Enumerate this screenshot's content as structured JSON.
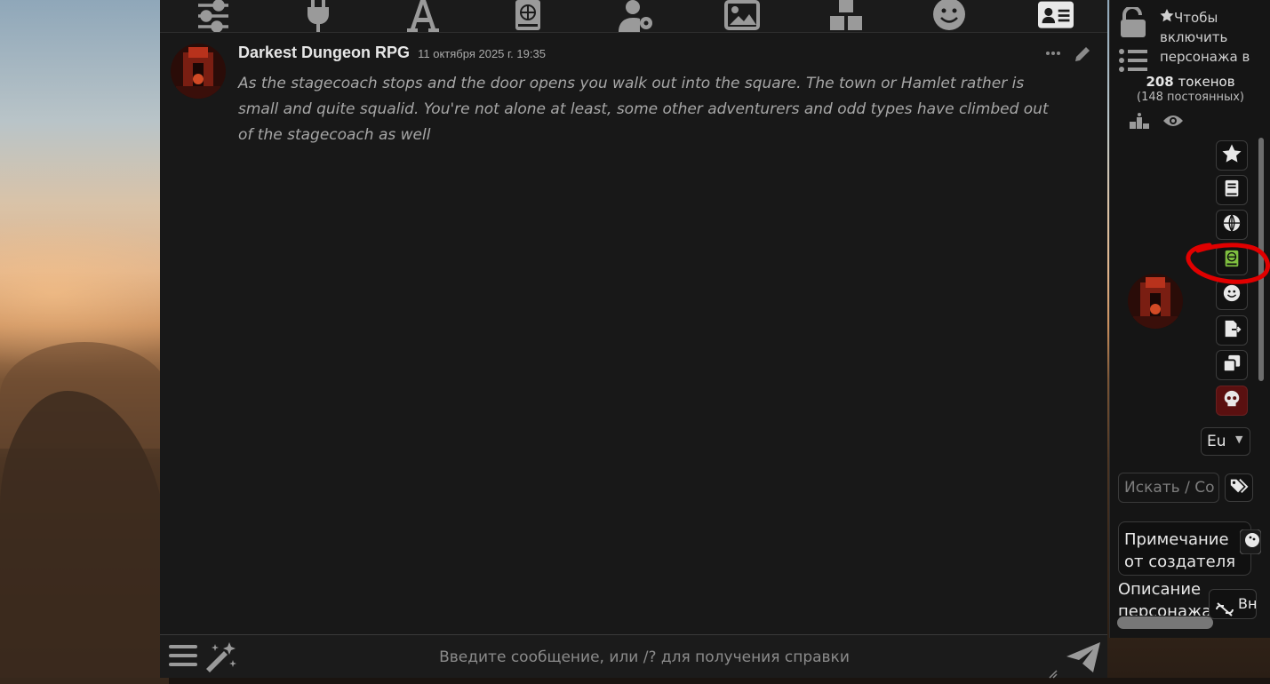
{
  "topbar": {
    "icons": [
      "sliders-icon",
      "plug-icon",
      "font-icon",
      "book-atlas-icon",
      "user-gear-icon",
      "image-icon",
      "cubes-icon",
      "smile-icon",
      "address-card-icon"
    ]
  },
  "message": {
    "author": "Darkest Dungeon RPG",
    "timestamp": "11 октября 2025 г. 19:35",
    "text": "As the stagecoach stops and the door opens you walk out into the square. The town or Hamlet rather is small and quite squalid. You're not alone at least, some other adventurers and odd types have climbed out of the stagecoach as well"
  },
  "input": {
    "placeholder": "Введите сообщение, или /? для получения справки",
    "value": ""
  },
  "right_panel": {
    "favorite_hint": "Чтобы включить персонажа в",
    "token_count": "208",
    "token_label": "токенов",
    "permanent_tokens": "(148 постоянных)",
    "language_select": "Eu",
    "search_placeholder": "Искать / Со",
    "creator_note": "Примечание от создателя",
    "description_label": "Описание персонажа",
    "toggle_label": "Вн"
  },
  "colors": {
    "panel_bg": "#181818",
    "accent_green": "#7fbf3f",
    "annotation_red": "#e00000",
    "danger_bg": "#5a1010"
  }
}
